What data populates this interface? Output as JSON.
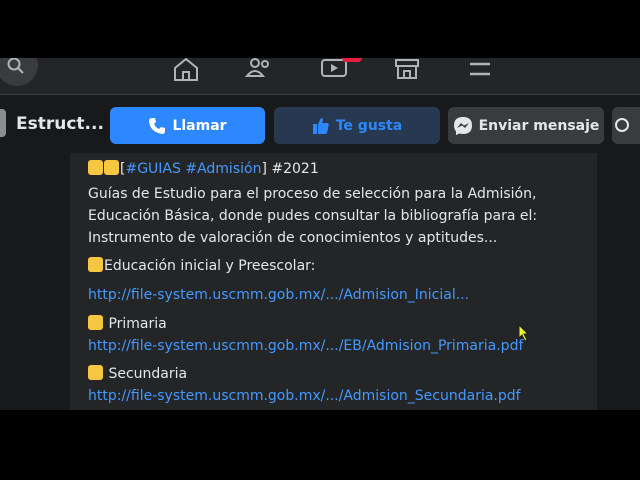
{
  "nav": {
    "icons": [
      "search-icon",
      "home-icon",
      "friends-icon",
      "watch-icon",
      "marketplace-icon",
      "menu-icon"
    ]
  },
  "page": {
    "name": "Estruct..."
  },
  "actions": {
    "call_label": "Llamar",
    "like_label": "Te gusta",
    "message_label": "Enviar mensaje"
  },
  "post": {
    "header_open": "[",
    "hashtag_1": "#GUIAS",
    "hashtag_2": "#Admisión",
    "header_close": "] #2021",
    "description": "Guías de Estudio para el proceso de selección para la Admisión, Educación Básica, donde pudes consultar la bibliografía para el: Instrumento de valoración de conocimientos y aptitudes...",
    "sections": [
      {
        "title": "Educación inicial y Preescolar:",
        "link": "http://file-system.uscmm.gob.mx/.../Admision_Inicial..."
      },
      {
        "title": " Primaria",
        "link": "http://file-system.uscmm.gob.mx/.../EB/Admision_Primaria.pdf"
      },
      {
        "title": " Secundaria",
        "link": "http://file-system.uscmm.gob.mx/.../Admision_Secundaria.pdf"
      }
    ]
  },
  "colors": {
    "accent": "#2d88ff",
    "link": "#4599ff",
    "emoji": "#f7c744",
    "badge": "#e41e3f"
  }
}
